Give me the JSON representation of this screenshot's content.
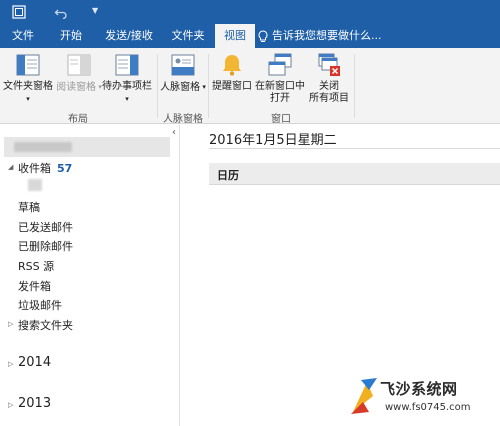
{
  "ribbon_tabs": [
    {
      "label": "文件"
    },
    {
      "label": "开始"
    },
    {
      "label": "发送/接收"
    },
    {
      "label": "文件夹"
    },
    {
      "label": "视图"
    }
  ],
  "tell_me": "告诉我您想要做什么...",
  "ribbon": {
    "buttons": [
      {
        "label": "文件夹窗格",
        "dropdown": true
      },
      {
        "label": "阅读窗格",
        "dropdown": true
      },
      {
        "label": "待办事项栏",
        "dropdown": true
      },
      {
        "label": "人脉窗格",
        "dropdown": true
      },
      {
        "label": "提醒窗口"
      },
      {
        "label_line1": "在新窗口中",
        "label_line2": "打开"
      },
      {
        "label_line1": "关闭",
        "label_line2": "所有项目"
      }
    ],
    "groups": [
      {
        "label": "布局"
      },
      {
        "label": "人脉窗格"
      },
      {
        "label": "窗口"
      }
    ]
  },
  "folder_pane": {
    "inbox": {
      "label": "收件箱",
      "count": "57"
    },
    "folders": [
      "草稿",
      "已发送邮件",
      "已删除邮件",
      "RSS 源",
      "发件箱",
      "垃圾邮件",
      "搜索文件夹"
    ],
    "archives": [
      "2014",
      "2013"
    ]
  },
  "main": {
    "date_title": "2016年1月5日星期二",
    "calendar_label": "日历"
  },
  "watermark": {
    "text": "飞沙系统网",
    "url": "www.fs0745.com"
  },
  "colors": {
    "accent": "#1e5fa8",
    "ribbon_bg": "#f3f3f3"
  }
}
